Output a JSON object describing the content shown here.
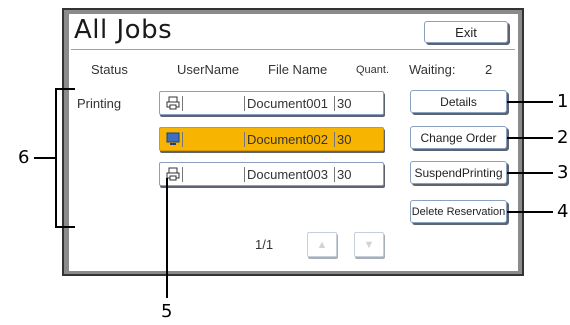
{
  "title": "All Jobs",
  "exit_label": "Exit",
  "headers": {
    "status": "Status",
    "username": "UserName",
    "filename": "File Name",
    "quantity": "Quant.",
    "waiting_label": "Waiting:",
    "waiting_count": "2"
  },
  "status_printing": "Printing",
  "jobs": [
    {
      "file": "Document001",
      "qty": "30",
      "selected": false
    },
    {
      "file": "Document002",
      "qty": "30",
      "selected": true
    },
    {
      "file": "Document003",
      "qty": "30",
      "selected": false
    }
  ],
  "buttons": {
    "details": "Details",
    "change_order": "Change Order",
    "suspend_printing": "SuspendPrinting",
    "delete_reservation": "Delete Reservation"
  },
  "pagination": {
    "indicator": "1/1",
    "up_icon": "▲",
    "down_icon": "▼"
  },
  "callouts": [
    "1",
    "2",
    "3",
    "4",
    "5",
    "6"
  ],
  "colors": {
    "selected_row": "#f7b400",
    "frame": "#8b8b8b"
  }
}
